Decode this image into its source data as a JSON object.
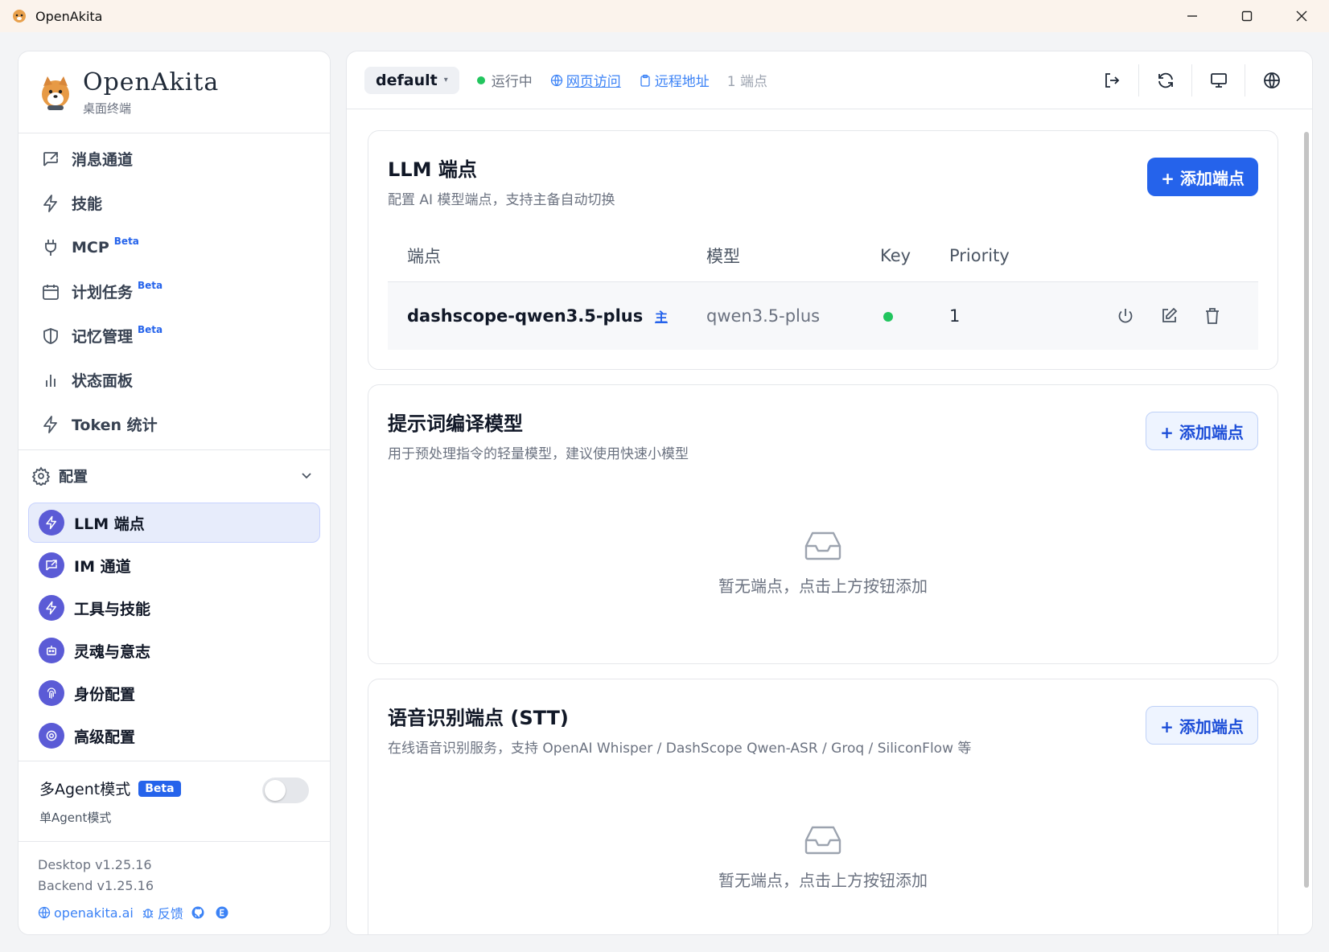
{
  "window": {
    "title": "OpenAkita"
  },
  "brand": {
    "name": "OpenAkita",
    "subtitle": "桌面终端"
  },
  "nav": {
    "items": [
      {
        "label": "消息通道",
        "icon": "message-export-icon",
        "beta": ""
      },
      {
        "label": "技能",
        "icon": "bolt-icon",
        "beta": ""
      },
      {
        "label": "MCP",
        "icon": "plug-icon",
        "beta": "Beta"
      },
      {
        "label": "计划任务",
        "icon": "calendar-icon",
        "beta": "Beta"
      },
      {
        "label": "记忆管理",
        "icon": "shield-icon",
        "beta": "Beta"
      },
      {
        "label": "状态面板",
        "icon": "bar-chart-icon",
        "beta": ""
      },
      {
        "label": "Token 统计",
        "icon": "bolt-icon",
        "beta": ""
      }
    ]
  },
  "config": {
    "label": "配置",
    "items": [
      {
        "label": "LLM 端点",
        "icon": "bolt-icon",
        "active": true
      },
      {
        "label": "IM 通道",
        "icon": "message-export-icon",
        "active": false
      },
      {
        "label": "工具与技能",
        "icon": "bolt-icon",
        "active": false
      },
      {
        "label": "灵魂与意志",
        "icon": "robot-icon",
        "active": false
      },
      {
        "label": "身份配置",
        "icon": "fingerprint-icon",
        "active": false
      },
      {
        "label": "高级配置",
        "icon": "gear-icon",
        "active": false
      }
    ]
  },
  "agent_mode": {
    "label": "多Agent模式",
    "badge": "Beta",
    "sub": "单Agent模式",
    "enabled": false
  },
  "footer": {
    "desktop_version": "Desktop v1.25.16",
    "backend_version": "Backend v1.25.16",
    "site": "openakita.ai",
    "feedback": "反馈"
  },
  "topbar": {
    "workspace": "default",
    "status": "运行中",
    "web_access": "网页访问",
    "remote_address": "远程地址",
    "endpoint_count": "1 端点"
  },
  "llm_card": {
    "title": "LLM 端点",
    "desc": "配置 AI 模型端点，支持主备自动切换",
    "add_label": "+ 添加端点",
    "columns": [
      "端点",
      "模型",
      "Key",
      "Priority"
    ],
    "rows": [
      {
        "endpoint": "dashscope-qwen3.5-plus",
        "primary_tag": "主",
        "model": "qwen3.5-plus",
        "key_ok": true,
        "priority": "1"
      }
    ]
  },
  "prompt_card": {
    "title": "提示词编译模型",
    "desc": "用于预处理指令的轻量模型，建议使用快速小模型",
    "add_label": "+ 添加端点",
    "empty_text": "暂无端点，点击上方按钮添加"
  },
  "stt_card": {
    "title": "语音识别端点 (STT)",
    "desc": "在线语音识别服务，支持 OpenAI Whisper / DashScope Qwen-ASR / Groq / SiliconFlow 等",
    "add_label": "+ 添加端点",
    "empty_text": "暂无端点，点击上方按钮添加"
  },
  "colors": {
    "accent": "#2563eb",
    "status_green": "#22c55e",
    "icon_circle": "#5b5bd6"
  }
}
